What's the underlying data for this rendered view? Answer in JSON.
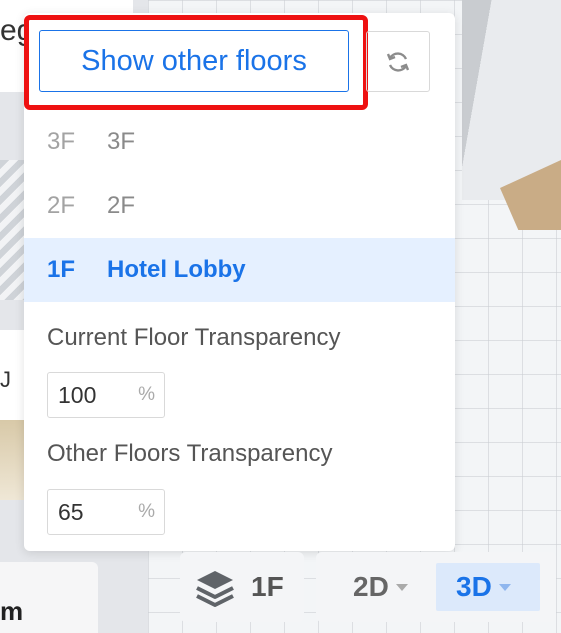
{
  "background": {
    "left_top_text": "eg",
    "left_mid_text": "J",
    "left_bottom_text": "m"
  },
  "floor_panel": {
    "show_other_floors_label": "Show other floors",
    "refresh_icon": "refresh-icon",
    "floors": [
      {
        "code": "3F",
        "name": "3F",
        "active": false
      },
      {
        "code": "2F",
        "name": "2F",
        "active": false
      },
      {
        "code": "1F",
        "name": "Hotel Lobby",
        "active": true
      }
    ],
    "current_floor_transparency": {
      "label": "Current Floor Transparency",
      "value": "100",
      "unit": "%"
    },
    "other_floors_transparency": {
      "label": "Other Floors Transparency",
      "value": "65",
      "unit": "%"
    }
  },
  "toolbar": {
    "floor_button": {
      "icon": "layers-icon",
      "label": "1F"
    },
    "view_2d_label": "2D",
    "view_3d_label": "3D",
    "active_view": "3D"
  },
  "colors": {
    "accent": "#1a73e8",
    "highlight": "#ee1111",
    "active_row_bg": "#e5f0ff"
  }
}
